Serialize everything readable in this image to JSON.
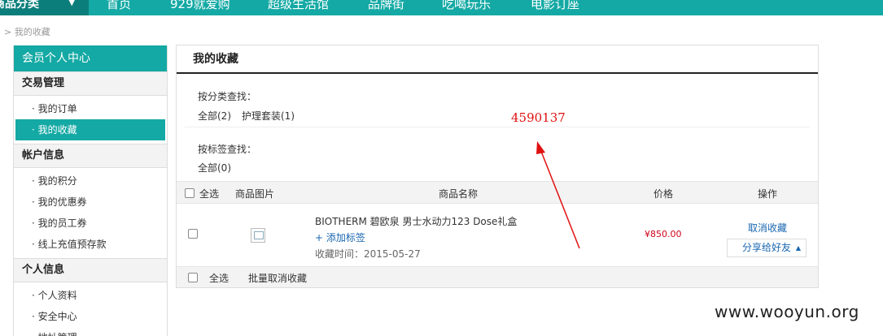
{
  "topnav": {
    "category_label": "商品分类",
    "items": [
      "首页",
      "929就爱购",
      "超级生活馆",
      "品牌街",
      "吃喝玩乐",
      "电影订座"
    ]
  },
  "breadcrumb": "> 我的收藏",
  "sidebar": {
    "title": "会员个人中心",
    "groups": [
      {
        "label": "交易管理",
        "items": [
          "· 我的订单",
          "· 我的收藏"
        ]
      },
      {
        "label": "帐户信息",
        "items": [
          "· 我的积分",
          "· 我的优惠券",
          "· 我的员工券",
          "· 线上充值预存款"
        ]
      },
      {
        "label": "个人信息",
        "items": [
          "· 个人资料",
          "· 安全中心",
          "· 地址管理"
        ]
      }
    ],
    "active_item": "· 我的收藏"
  },
  "panel": {
    "title": "我的收藏",
    "category_filter": {
      "label": "按分类查找：",
      "options": [
        "全部(2)",
        "护理套装(1)"
      ]
    },
    "tag_filter": {
      "label": "按标签查找：",
      "options": [
        "全部(0)"
      ]
    },
    "table": {
      "headers": {
        "select_all": "全选",
        "image": "商品图片",
        "name": "商品名称",
        "price": "价格",
        "action": "操作"
      },
      "rows": [
        {
          "name": "BIOTHERM 碧欧泉 男士水动力123 Dose礼盒",
          "add_tag": "+ 添加标签",
          "collected_time": "收藏时间：2015-05-27",
          "price": "¥850.00",
          "cancel": "取消收藏",
          "share": "分享给好友"
        }
      ],
      "footer": {
        "select_all": "全选",
        "batch_cancel": "批量取消收藏"
      }
    }
  },
  "annotation": {
    "text": "4590137",
    "color": "#e01010"
  },
  "watermark": "www.wooyun.org",
  "colors": {
    "accent": "#14a9a4",
    "price": "#d0021b",
    "link": "#1a67b0"
  }
}
